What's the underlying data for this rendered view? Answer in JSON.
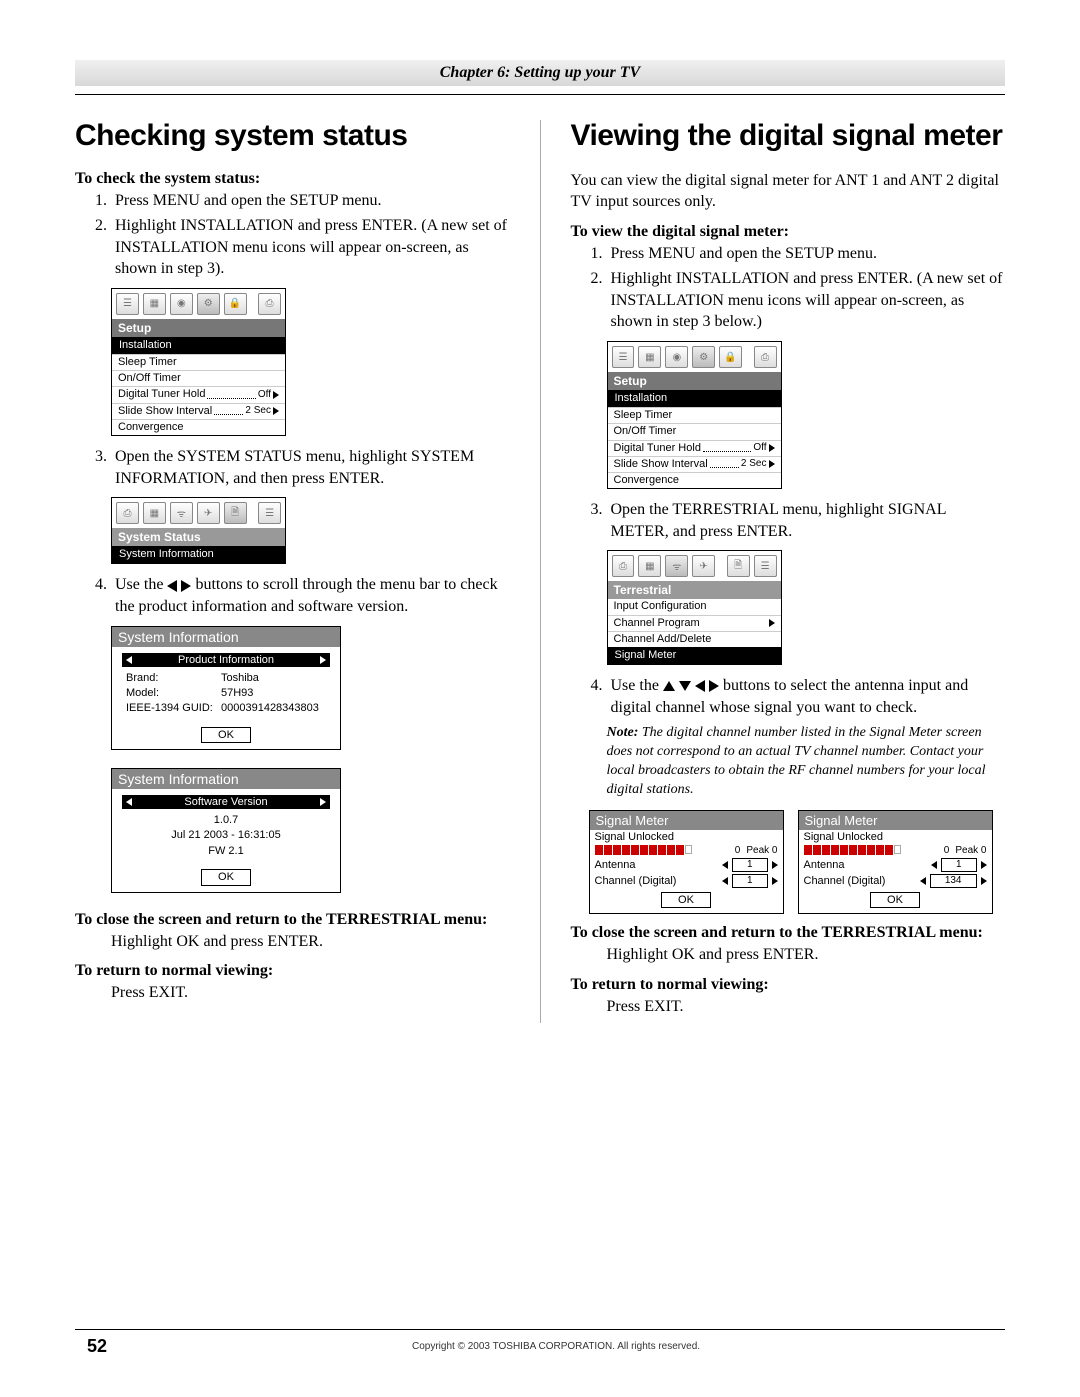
{
  "chapter": "Chapter 6: Setting up your TV",
  "left": {
    "h1": "Checking system status",
    "lead1": "To check the system status:",
    "steps1": [
      "Press MENU and open the SETUP menu.",
      "Highlight INSTALLATION and press ENTER. (A new set of INSTALLATION menu icons will appear on-screen, as shown in step 3)."
    ],
    "step3": "Open the SYSTEM STATUS menu, highlight SYSTEM INFORMATION, and then press ENTER.",
    "step4a": "Use the ",
    "step4b": " buttons to scroll through the menu bar to check the product information and software version.",
    "close_lead": "To close the screen and return to the TERRESTRIAL menu:",
    "close_body": "Highlight OK and press ENTER.",
    "return_lead": "To return to normal viewing:",
    "return_body": "Press EXIT."
  },
  "right": {
    "h1": "Viewing the digital signal meter",
    "intro": "You can view the digital signal meter for ANT 1 and ANT 2 digital TV input sources only.",
    "lead1": "To view the digital signal meter:",
    "steps1": [
      "Press MENU and open the SETUP menu.",
      "Highlight INSTALLATION and press ENTER. (A new set of INSTALLATION menu icons will appear on-screen, as shown in step 3 below.)"
    ],
    "step3": "Open the TERRESTRIAL menu, highlight SIGNAL METER, and press ENTER.",
    "step4a": "Use the ",
    "step4b": " buttons to select the antenna input and digital channel whose signal you want to check.",
    "note_label": "Note:",
    "note_body": " The digital channel number listed in the Signal Meter screen does not correspond to an actual TV channel number. Contact your local broadcasters to obtain the RF channel numbers for your local digital stations.",
    "close_lead": "To close the screen and return to the TERRESTRIAL menu:",
    "close_body": "Highlight OK and press ENTER.",
    "return_lead": "To return to normal viewing:",
    "return_body": "Press EXIT."
  },
  "setup_menu": {
    "title": "Setup",
    "installation": "Installation",
    "rows": [
      {
        "label": "Sleep Timer"
      },
      {
        "label": "On/Off Timer"
      },
      {
        "label": "Digital Tuner Hold",
        "dots": true,
        "val": "Off",
        "arrow": true
      },
      {
        "label": "Slide Show Interval",
        "dots": true,
        "val": "2 Sec",
        "arrow": true
      },
      {
        "label": "Convergence"
      }
    ]
  },
  "status_menu": {
    "title": "System Status",
    "row": "System Information"
  },
  "terrestrial_menu": {
    "title": "Terrestrial",
    "rows": [
      "Input Configuration",
      "Channel Program",
      "Channel Add/Delete"
    ],
    "program_arrow": true,
    "highlight": "Signal Meter"
  },
  "sysinfo1": {
    "title": "System Information",
    "sub": "Product Information",
    "brand_k": "Brand:",
    "brand_v": "Toshiba",
    "model_k": "Model:",
    "model_v": "57H93",
    "guid_k": "IEEE-1394 GUID:",
    "guid_v": "0000391428343803",
    "ok": "OK"
  },
  "sysinfo2": {
    "title": "System Information",
    "sub": "Software Version",
    "l1": "1.0.7",
    "l2": "Jul 21 2003 - 16:31:05",
    "l3": "FW 2.1",
    "ok": "OK"
  },
  "meter1": {
    "title": "Signal Meter",
    "status": "Signal Unlocked",
    "zero": "0",
    "peak": "Peak  0",
    "antenna": "Antenna",
    "antenna_v": "1",
    "channel": "Channel (Digital)",
    "channel_v": "1",
    "ok": "OK"
  },
  "meter2": {
    "title": "Signal Meter",
    "status": "Signal Unlocked",
    "zero": "0",
    "peak": "Peak  0",
    "antenna": "Antenna",
    "antenna_v": "1",
    "channel": "Channel (Digital)",
    "channel_v": "134",
    "ok": "OK"
  },
  "footer": {
    "page": "52",
    "copy": "Copyright © 2003 TOSHIBA CORPORATION. All rights reserved."
  }
}
